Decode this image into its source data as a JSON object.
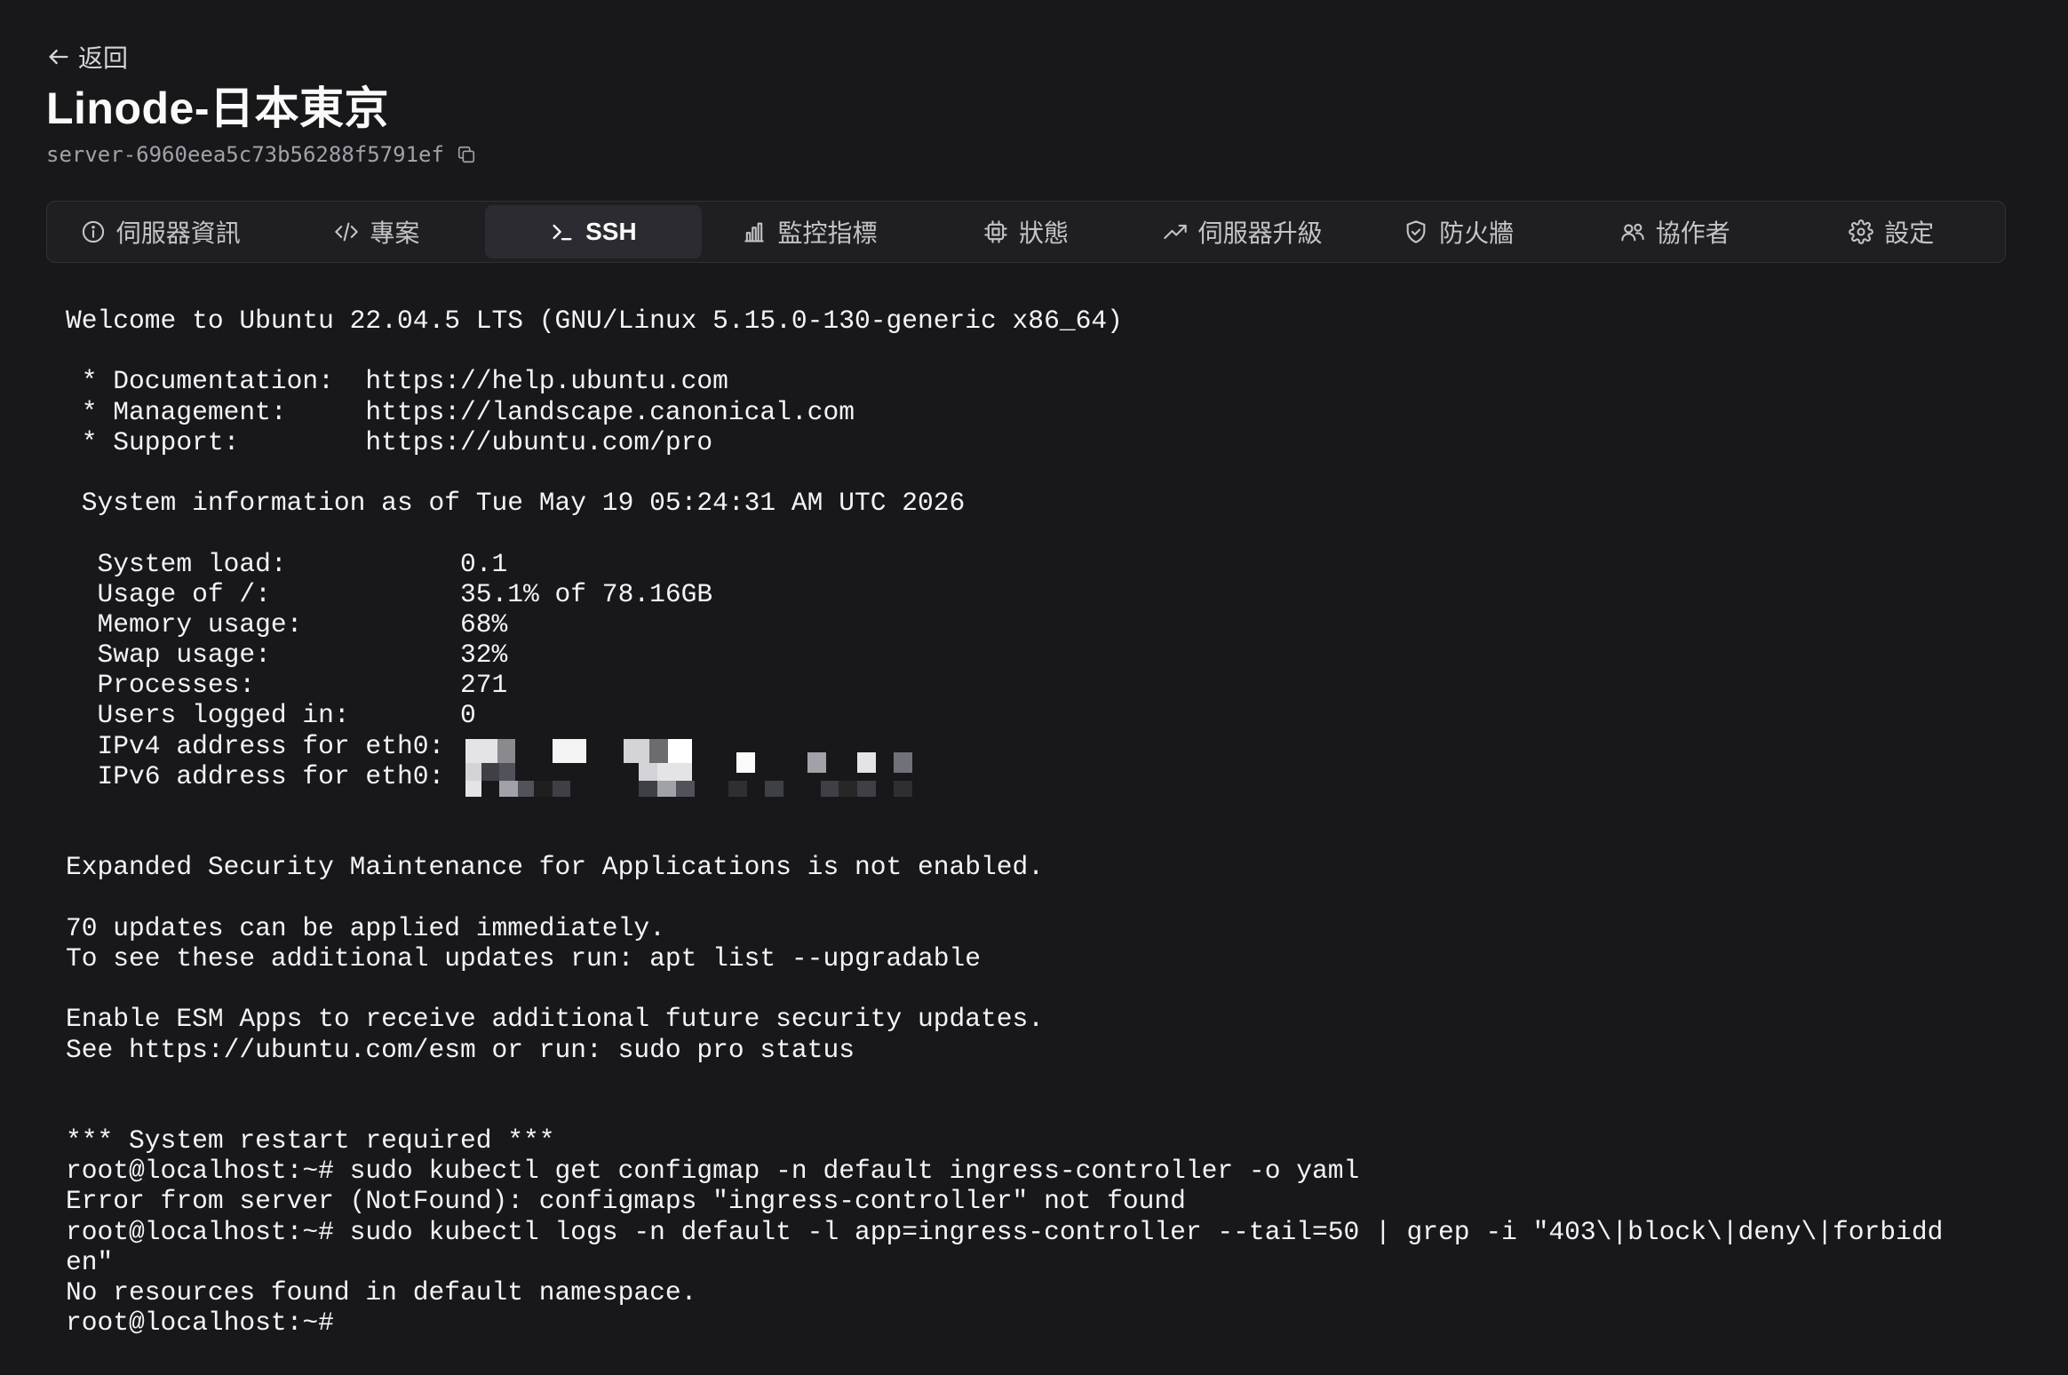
{
  "header": {
    "back_label": "返回",
    "title": "Linode-日本東京",
    "server_id": "server-6960eea5c73b56288f5791ef"
  },
  "tabs": [
    {
      "label": "伺服器資訊",
      "icon": "info-icon"
    },
    {
      "label": "專案",
      "icon": "code-icon"
    },
    {
      "label": "SSH",
      "icon": "terminal-icon",
      "active": true
    },
    {
      "label": "監控指標",
      "icon": "bar-chart-icon"
    },
    {
      "label": "狀態",
      "icon": "cpu-icon"
    },
    {
      "label": "伺服器升級",
      "icon": "trend-up-icon"
    },
    {
      "label": "防火牆",
      "icon": "shield-icon"
    },
    {
      "label": "協作者",
      "icon": "users-icon"
    },
    {
      "label": "設定",
      "icon": "gear-icon"
    }
  ],
  "terminal": {
    "lines": [
      "Welcome to Ubuntu 22.04.5 LTS (GNU/Linux 5.15.0-130-generic x86_64)",
      "",
      " * Documentation:  https://help.ubuntu.com",
      " * Management:     https://landscape.canonical.com",
      " * Support:        https://ubuntu.com/pro",
      "",
      " System information as of Tue May 19 05:24:31 AM UTC 2026",
      "",
      "  System load:           0.1",
      "  Usage of /:            35.1% of 78.16GB",
      "  Memory usage:          68%",
      "  Swap usage:            32%",
      "  Processes:             271",
      "  Users logged in:       0",
      "  IPv4 address for eth0:",
      "  IPv6 address for eth0:",
      "",
      "",
      "Expanded Security Maintenance for Applications is not enabled.",
      "",
      "70 updates can be applied immediately.",
      "To see these additional updates run: apt list --upgradable",
      "",
      "Enable ESM Apps to receive additional future security updates.",
      "See https://ubuntu.com/esm or run: sudo pro status",
      "",
      "",
      "*** System restart required ***",
      "root@localhost:~# sudo kubectl get configmap -n default ingress-controller -o yaml",
      "Error from server (NotFound): configmaps \"ingress-controller\" not found",
      "root@localhost:~# sudo kubectl logs -n default -l app=ingress-controller --tail=50 | grep -i \"403\\|block\\|deny\\|forbidd",
      "en\"",
      "No resources found in default namespace.",
      "root@localhost:~# "
    ]
  }
}
